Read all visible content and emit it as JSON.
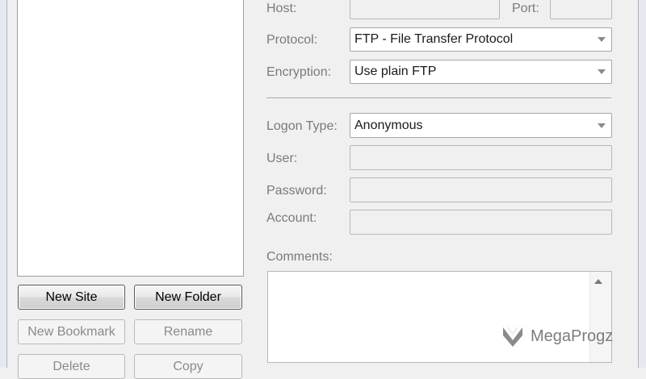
{
  "site_manager": {
    "buttons": {
      "new_site": "New Site",
      "new_folder": "New Folder",
      "new_bookmark": "New Bookmark",
      "rename": "Rename",
      "delete": "Delete",
      "copy": "Copy"
    }
  },
  "general": {
    "host_label": "Host:",
    "host_value": "",
    "port_label": "Port:",
    "port_value": "",
    "protocol_label": "Protocol:",
    "protocol_value": "FTP - File Transfer Protocol",
    "encryption_label": "Encryption:",
    "encryption_value": "Use plain FTP",
    "logon_type_label": "Logon Type:",
    "logon_type_value": "Anonymous",
    "user_label": "User:",
    "user_value": "",
    "password_label": "Password:",
    "password_value": "",
    "account_label": "Account:",
    "account_value": "",
    "comments_label": "Comments:",
    "comments_value": ""
  },
  "watermark": {
    "text": "MegaProgz",
    "icon": "megaprogz-logo-icon"
  },
  "colors": {
    "disabled_label": "#7a7a7a",
    "field_disabled_bg": "#f0f0f0",
    "window_bg": "#f0f0f0"
  }
}
